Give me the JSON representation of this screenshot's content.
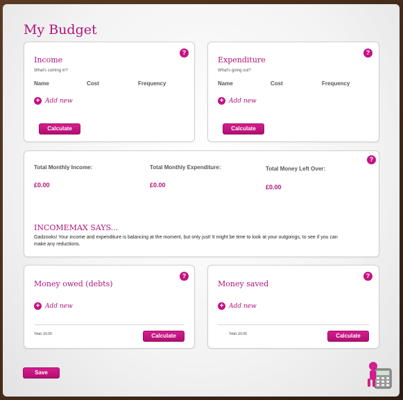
{
  "page": {
    "title": "My Budget"
  },
  "income": {
    "title": "Income",
    "subtitle": "What's coming in?",
    "columns": [
      "Name",
      "Cost",
      "Frequency"
    ],
    "add_label": "Add new",
    "calculate_label": "Calculate",
    "help": "?"
  },
  "expenditure": {
    "title": "Expenditure",
    "subtitle": "What's going out?",
    "columns": [
      "Name",
      "Cost",
      "Frequency"
    ],
    "add_label": "Add new",
    "calculate_label": "Calculate",
    "help": "?"
  },
  "summary": {
    "help": "?",
    "total_income_label": "Total Monthly Income:",
    "total_income_value": "£0.00",
    "total_expenditure_label": "Total Monthly Expenditure:",
    "total_expenditure_value": "£0.00",
    "left_over_label": "Total Money Left Over:",
    "left_over_value": "£0.00",
    "says_title": "INCOMEMAX SAYS...",
    "says_text": "Gadzooks! Your income and expenditure is balancing at the moment, but only just! It might be time to look at your outgoings, to see if you can make any reductions."
  },
  "debts": {
    "title": "Money owed (debts)",
    "add_label": "Add new",
    "total_label": "Total: £0.00",
    "calculate_label": "Calculate",
    "help": "?"
  },
  "saved": {
    "title": "Money saved",
    "add_label": "Add new",
    "total_label": "Total: £0.00",
    "calculate_label": "Calculate",
    "help": "?"
  },
  "footer": {
    "save_label": "Save",
    "icon": "calculator-mascot-icon"
  },
  "colors": {
    "accent": "#b0127a",
    "button": "#c41383"
  }
}
